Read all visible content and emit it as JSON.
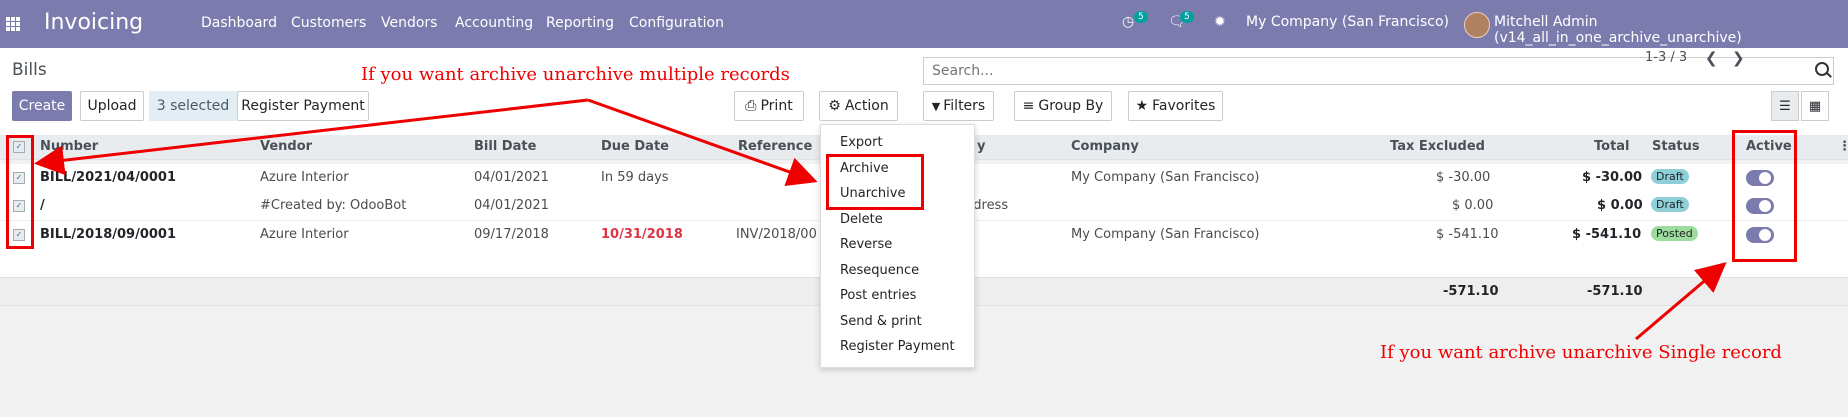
{
  "app": {
    "title": "Invoicing",
    "menu": [
      "Dashboard",
      "Customers",
      "Vendors",
      "Accounting",
      "Reporting",
      "Configuration"
    ],
    "activity_count": "5",
    "message_count": "5",
    "company": "My Company (San Francisco)",
    "user": "Mitchell Admin (v14_all_in_one_archive_unarchive)"
  },
  "control": {
    "breadcrumb": "Bills",
    "create": "Create",
    "upload": "Upload",
    "selected": "3 selected",
    "register_payment": "Register Payment",
    "print": "Print",
    "action": "Action",
    "search_placeholder": "Search...",
    "filters": "Filters",
    "group_by": "Group By",
    "favorites": "Favorites",
    "pager": "1-3 / 3"
  },
  "table": {
    "headers": [
      "Number",
      "Vendor",
      "Bill Date",
      "Due Date",
      "Reference",
      "y",
      "Company",
      "Tax Excluded",
      "Total",
      "Status",
      "Active"
    ],
    "rows": [
      {
        "number": "BILL/2021/04/0001",
        "vendor": "Azure Interior",
        "bill_date": "04/01/2021",
        "due_date": "In 59 days",
        "reference": "",
        "extra": "",
        "company": "My Company (San Francisco)",
        "tax_excluded": "$ -30.00",
        "total": "$ -30.00",
        "status": "Draft"
      },
      {
        "number": "/",
        "vendor": "#Created by: OdooBot",
        "bill_date": "04/01/2021",
        "due_date": "",
        "reference": "",
        "extra": "ddress",
        "company": "",
        "tax_excluded": "$ 0.00",
        "total": "$ 0.00",
        "status": "Draft"
      },
      {
        "number": "BILL/2018/09/0001",
        "vendor": "Azure Interior",
        "bill_date": "09/17/2018",
        "due_date": "10/31/2018",
        "reference": "INV/2018/00",
        "extra": "",
        "company": "My Company (San Francisco)",
        "tax_excluded": "$ -541.10",
        "total": "$ -541.10",
        "status": "Posted"
      }
    ],
    "footer": {
      "tax_excluded": "-571.10",
      "total": "-571.10"
    }
  },
  "dropdown": [
    "Export",
    "Archive",
    "Unarchive",
    "Delete",
    "Reverse",
    "Resequence",
    "Post entries",
    "Send & print",
    "Register Payment"
  ],
  "annotations": {
    "multiple": "If you want archive unarchive multiple records",
    "single": "If you want archive unarchive Single record"
  },
  "colors": {
    "brand": "#7c7bad",
    "annotation": "#ee0000"
  }
}
